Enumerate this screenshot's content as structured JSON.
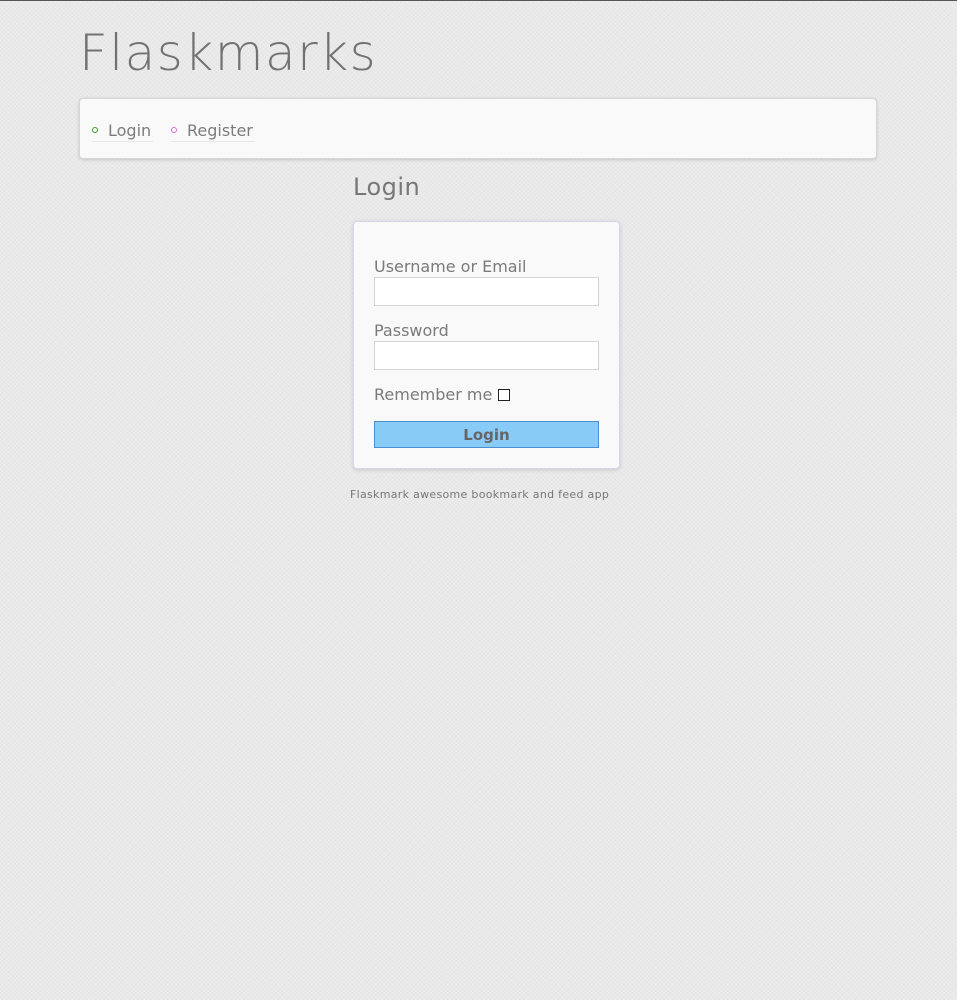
{
  "site": {
    "title": "Flaskmarks"
  },
  "nav": {
    "items": [
      {
        "label": "Login",
        "dot_color": "#3c9a1f"
      },
      {
        "label": "Register",
        "dot_color": "#d96ad9"
      }
    ]
  },
  "login_form": {
    "heading": "Login",
    "username_label": "Username or Email",
    "username_value": "",
    "password_label": "Password",
    "password_value": "",
    "remember_label": "Remember me",
    "remember_checked": false,
    "submit_label": "Login",
    "submit_color": "#87cbf6"
  },
  "footer": {
    "text": "Flaskmark awesome bookmark and feed app"
  }
}
